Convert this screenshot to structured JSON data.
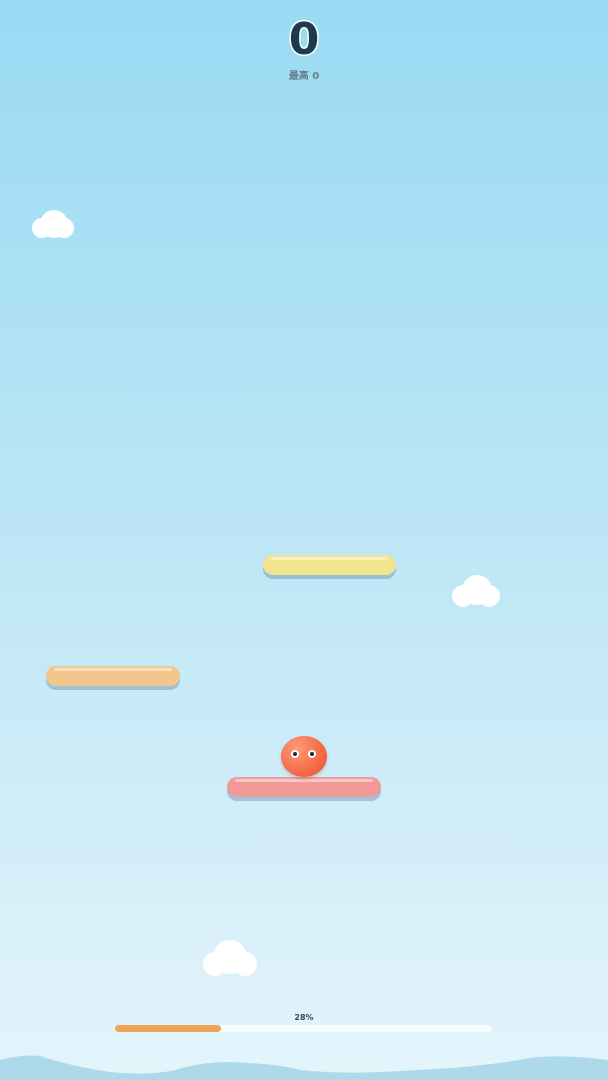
{
  "hud": {
    "score": "0",
    "best_label": "最高 0"
  },
  "progress": {
    "label": "28%",
    "fraction": 0.28,
    "fill_color": "#f2a35a",
    "track_color": "#ffffff"
  },
  "scene": {
    "sky_top_color": "#99daf3",
    "sky_bottom_color": "#e4f4fb",
    "platform_colors": [
      "#f2e48c",
      "#f2c68c",
      "#f29a9a"
    ],
    "player_color": "#f2633f",
    "hill_color": "#aed9ea"
  }
}
